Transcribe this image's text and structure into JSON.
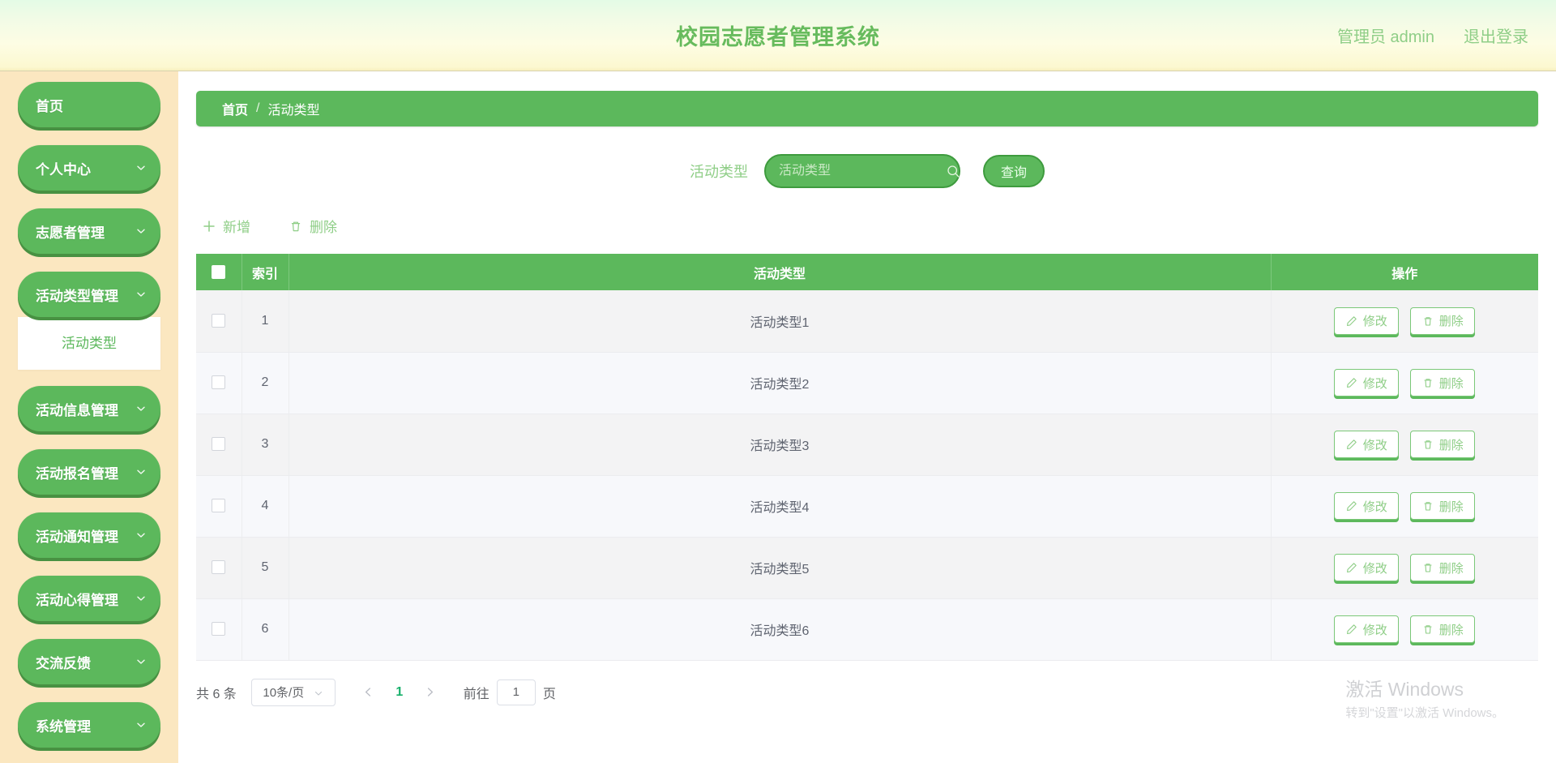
{
  "header": {
    "title": "校园志愿者管理系统",
    "user_label": "管理员 admin",
    "logout_label": "退出登录",
    "brand_color": "#67bb5d"
  },
  "sidebar": {
    "background": "#fbe7c0",
    "accent": "#5cb85c",
    "items": [
      {
        "label": "首页",
        "expandable": false
      },
      {
        "label": "个人中心",
        "expandable": true
      },
      {
        "label": "志愿者管理",
        "expandable": true
      },
      {
        "label": "活动类型管理",
        "expandable": true,
        "expanded": true,
        "children": [
          {
            "label": "活动类型",
            "active": true
          }
        ]
      },
      {
        "label": "活动信息管理",
        "expandable": true
      },
      {
        "label": "活动报名管理",
        "expandable": true
      },
      {
        "label": "活动通知管理",
        "expandable": true
      },
      {
        "label": "活动心得管理",
        "expandable": true
      },
      {
        "label": "交流反馈",
        "expandable": true
      },
      {
        "label": "系统管理",
        "expandable": true
      }
    ]
  },
  "breadcrumb": {
    "home": "首页",
    "separator": "/",
    "current": "活动类型"
  },
  "search": {
    "label": "活动类型",
    "placeholder": "活动类型",
    "value": "",
    "icon": "search-icon",
    "button_label": "查询"
  },
  "toolbar": {
    "add_label": "新增",
    "add_icon": "plus-icon",
    "delete_label": "删除",
    "delete_icon": "trash-icon"
  },
  "table": {
    "columns": [
      "",
      "索引",
      "活动类型",
      "操作"
    ],
    "header_bg": "#5cb85c",
    "rows": [
      {
        "index": "1",
        "type": "活动类型1"
      },
      {
        "index": "2",
        "type": "活动类型2"
      },
      {
        "index": "3",
        "type": "活动类型3"
      },
      {
        "index": "4",
        "type": "活动类型4"
      },
      {
        "index": "5",
        "type": "活动类型5"
      },
      {
        "index": "6",
        "type": "活动类型6"
      }
    ],
    "row_actions": {
      "edit_label": "修改",
      "edit_icon": "pencil-icon",
      "delete_label": "删除",
      "delete_icon": "trash-icon"
    }
  },
  "pagination": {
    "total_label": "共 6 条",
    "page_size_label": "10条/页",
    "prev_icon": "chevron-left-icon",
    "next_icon": "chevron-right-icon",
    "current_page": "1",
    "jump_prefix": "前往",
    "jump_value": "1",
    "jump_suffix": "页"
  },
  "watermark": {
    "title": "激活 Windows",
    "subtitle": "转到\"设置\"以激活 Windows。"
  }
}
